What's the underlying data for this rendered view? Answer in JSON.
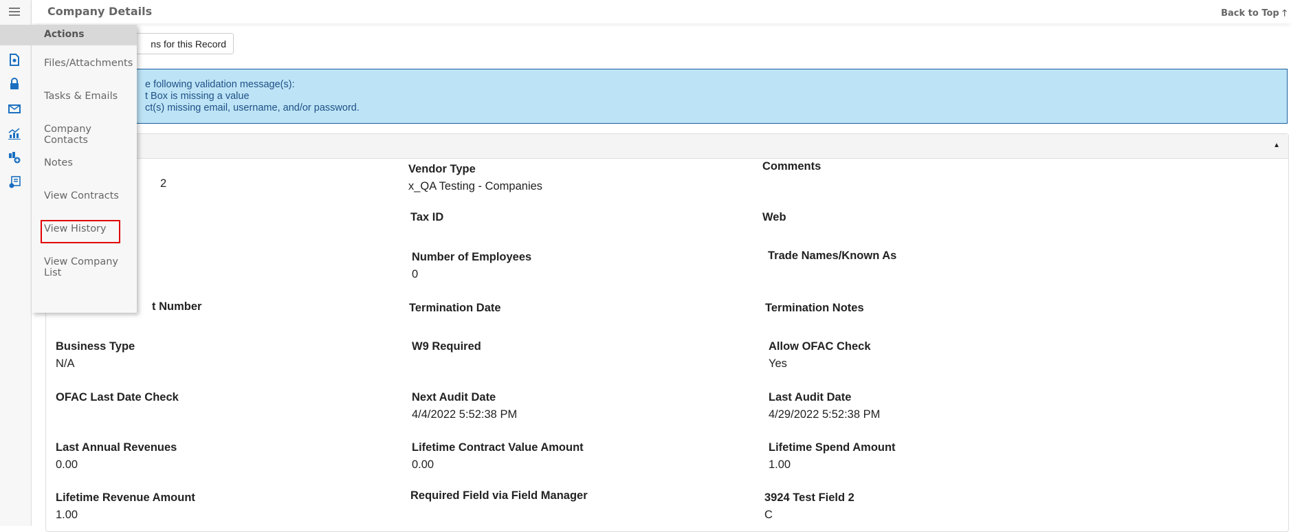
{
  "header": {
    "title": "Company Details",
    "back_to_top": "Back to Top",
    "back_to_top_icon": "arrow-up-icon"
  },
  "sidebar": {
    "icons": [
      "menu-icon",
      "gear-icon",
      "document-settings-icon",
      "lock-icon",
      "envelope-icon",
      "chart-icon",
      "org-add-icon",
      "form-settings-icon"
    ]
  },
  "actions_menu": {
    "title": "Actions",
    "items": [
      "Files/Attachments",
      "Tasks & Emails",
      "Company Contacts",
      "Notes",
      "View Contracts",
      "View History",
      "View Company List"
    ],
    "highlighted": "View History"
  },
  "record_button": {
    "label": "ns for this Record"
  },
  "validation": {
    "lines": [
      "e following validation message(s):",
      "t Box is missing a value",
      "ct(s) missing email, username, and/or password."
    ]
  },
  "colors": {
    "accent": "#1a6fc0",
    "info_bg": "#bde4f6",
    "highlight": "#e00000"
  },
  "fragments": {
    "first_value": "2",
    "account_label": "t Number"
  },
  "fields": [
    {
      "label": "Vendor Type",
      "value": "x_QA Testing - Companies"
    },
    {
      "label": "Comments",
      "value": ""
    },
    {
      "label": "Tax ID",
      "value": ""
    },
    {
      "label": "Web",
      "value": ""
    },
    {
      "label": "Number of Employees",
      "value": "0"
    },
    {
      "label": "Trade Names/Known As",
      "value": ""
    },
    {
      "label": "Termination Date",
      "value": ""
    },
    {
      "label": "Termination Notes",
      "value": ""
    },
    {
      "label": "Business Type",
      "value": "N/A"
    },
    {
      "label": "W9 Required",
      "value": ""
    },
    {
      "label": "Allow OFAC Check",
      "value": "Yes"
    },
    {
      "label": "OFAC Last Date Check",
      "value": ""
    },
    {
      "label": "Next Audit Date",
      "value": "4/4/2022 5:52:38 PM"
    },
    {
      "label": "Last Audit Date",
      "value": "4/29/2022 5:52:38 PM"
    },
    {
      "label": "Last Annual Revenues",
      "value": "0.00"
    },
    {
      "label": "Lifetime Contract Value Amount",
      "value": "0.00"
    },
    {
      "label": "Lifetime Spend Amount",
      "value": "1.00"
    },
    {
      "label": "Lifetime Revenue Amount",
      "value": "1.00"
    },
    {
      "label": "Required Field via Field Manager",
      "value": ""
    },
    {
      "label": "3924 Test Field 2",
      "value": "C"
    }
  ]
}
